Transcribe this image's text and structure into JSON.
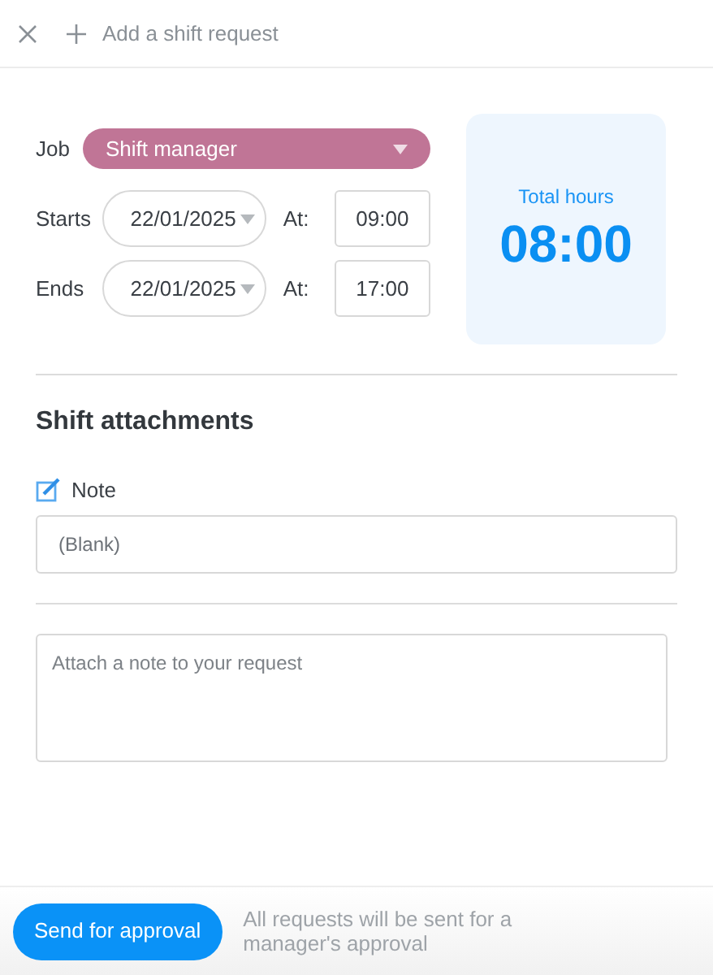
{
  "header": {
    "title": "Add a shift request"
  },
  "job": {
    "label": "Job",
    "value": "Shift manager",
    "color": "#c07596"
  },
  "schedule": [
    {
      "label": "Starts",
      "date": "22/01/2025",
      "at_label": "At:",
      "time": "09:00"
    },
    {
      "label": "Ends",
      "date": "22/01/2025",
      "at_label": "At:",
      "time": "17:00"
    }
  ],
  "total": {
    "label": "Total hours",
    "value": "08:00"
  },
  "attachments": {
    "heading": "Shift attachments",
    "note_label": "Note",
    "note_value": "(Blank)",
    "message_placeholder": "Attach a note to your request"
  },
  "footer": {
    "button": "Send for approval",
    "hint": "All requests will be sent for a manager's approval"
  }
}
